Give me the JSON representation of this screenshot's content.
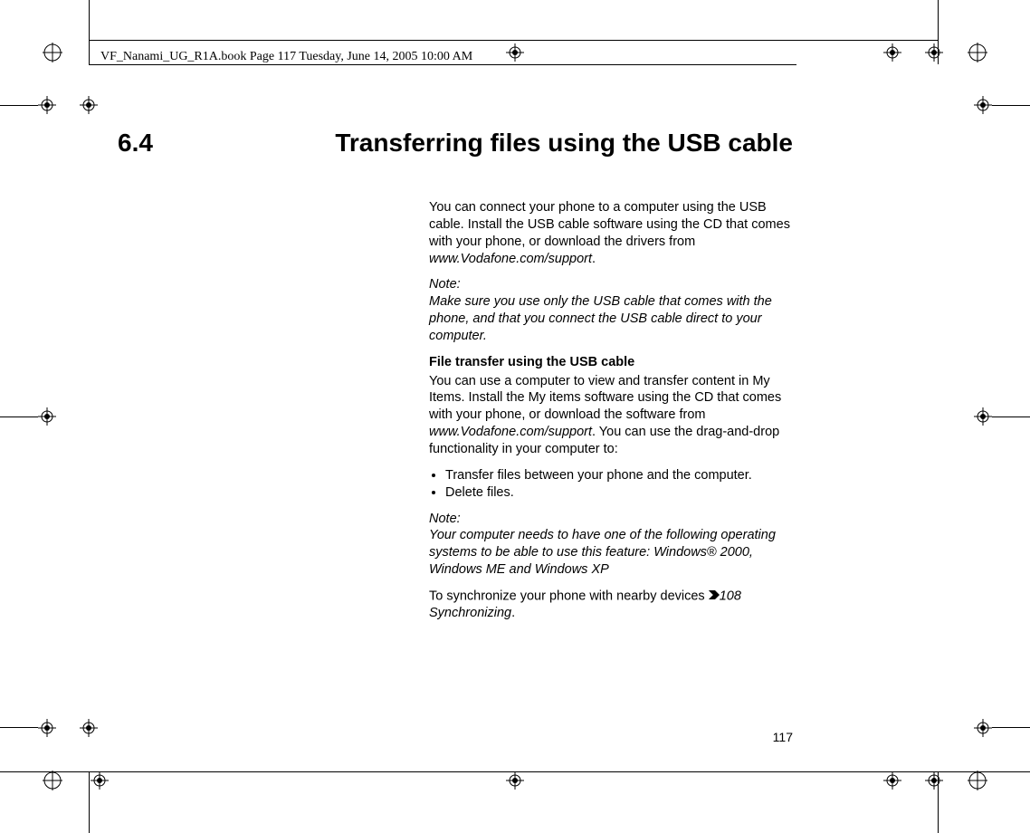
{
  "header": {
    "stamp": "VF_Nanami_UG_R1A.book  Page 117  Tuesday, June 14, 2005  10:00 AM"
  },
  "section": {
    "number": "6.4",
    "title": "Transferring files using the USB cable"
  },
  "body": {
    "intro_1": "You can connect your phone to a computer using the USB cable. Install the USB cable software using the CD that comes with your phone, or download the drivers from ",
    "intro_url": "www.Vodafone.com/support",
    "intro_2": ".",
    "note1_label": "Note:",
    "note1_text": "Make sure you use only the USB cable that comes with the phone, and that you connect the USB cable direct to your computer.",
    "subheading": "File transfer using the USB cable",
    "sub_intro_1": "You can use a computer to view and transfer content in My Items. Install the My items software using the CD that comes with your phone, or download the software from ",
    "sub_url": "www.Vodafone.com/support",
    "sub_intro_2": ". You can use the drag-and-drop functionality in your computer to:",
    "bullet1": "Transfer files between your phone and the computer.",
    "bullet2": "Delete files.",
    "note2_label": "Note:",
    "note2_text": "Your computer needs to have one of the following operating systems to be able to use this feature: Windows® 2000, Windows ME and Windows XP",
    "sync_1": "To synchronize your phone with nearby devices ",
    "sync_ref": "108 Synchronizing",
    "sync_2": "."
  },
  "page_number": "117"
}
